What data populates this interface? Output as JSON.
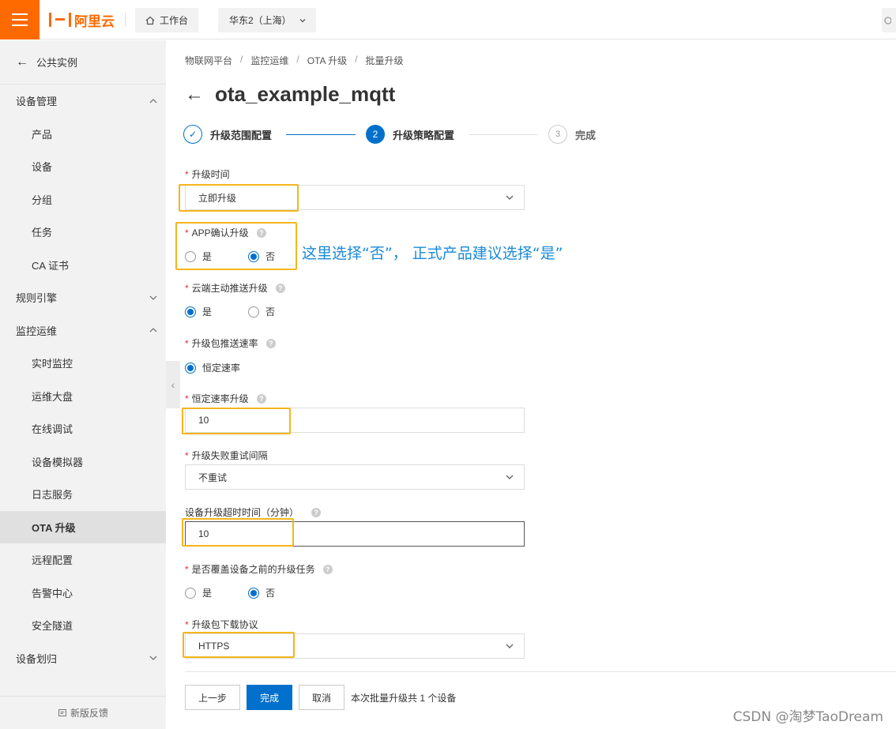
{
  "topbar": {
    "logo_text": "阿里云",
    "workbench_label": "工作台",
    "region_label": "华东2（上海）"
  },
  "sidebar": {
    "back_label": "公共实例",
    "items": [
      {
        "label": "设备管理",
        "type": "group",
        "expanded": true
      },
      {
        "label": "产品",
        "type": "child"
      },
      {
        "label": "设备",
        "type": "child"
      },
      {
        "label": "分组",
        "type": "child"
      },
      {
        "label": "任务",
        "type": "child"
      },
      {
        "label": "CA 证书",
        "type": "child"
      },
      {
        "label": "规则引擎",
        "type": "group",
        "expanded": false
      },
      {
        "label": "监控运维",
        "type": "group",
        "expanded": true
      },
      {
        "label": "实时监控",
        "type": "child"
      },
      {
        "label": "运维大盘",
        "type": "child"
      },
      {
        "label": "在线调试",
        "type": "child"
      },
      {
        "label": "设备模拟器",
        "type": "child"
      },
      {
        "label": "日志服务",
        "type": "child"
      },
      {
        "label": "OTA 升级",
        "type": "child",
        "active": true
      },
      {
        "label": "远程配置",
        "type": "child"
      },
      {
        "label": "告警中心",
        "type": "child"
      },
      {
        "label": "安全隧道",
        "type": "child"
      },
      {
        "label": "设备划归",
        "type": "group",
        "expanded": false
      }
    ],
    "feedback_label": "新版反馈"
  },
  "breadcrumb": [
    "物联网平台",
    "监控运维",
    "OTA 升级",
    "批量升级"
  ],
  "page_title": "ota_example_mqtt",
  "steps": [
    {
      "label": "升级范围配置",
      "status": "done",
      "marker": "✓"
    },
    {
      "label": "升级策略配置",
      "status": "current",
      "marker": "2"
    },
    {
      "label": "完成",
      "status": "todo",
      "marker": "3"
    }
  ],
  "form": {
    "upgrade_time": {
      "label": "升级时间",
      "value": "立即升级"
    },
    "app_confirm": {
      "label": "APP确认升级",
      "options": [
        "是",
        "否"
      ],
      "selected": "否"
    },
    "cloud_push": {
      "label": "云端主动推送升级",
      "options": [
        "是",
        "否"
      ],
      "selected": "是"
    },
    "push_rate": {
      "label": "升级包推送速率",
      "options": [
        "恒定速率"
      ],
      "selected": "恒定速率"
    },
    "constant_rate": {
      "label": "恒定速率升级",
      "value": "10"
    },
    "retry_interval": {
      "label": "升级失败重试间隔",
      "value": "不重试"
    },
    "timeout": {
      "label": "设备升级超时时间（分钟）",
      "value": "10"
    },
    "overwrite": {
      "label": "是否覆盖设备之前的升级任务",
      "options": [
        "是",
        "否"
      ],
      "selected": "否"
    },
    "protocol": {
      "label": "升级包下载协议",
      "value": "HTTPS"
    }
  },
  "annotation": "这里选择“否”， 正式产品建议选择“是”",
  "footer": {
    "prev_label": "上一步",
    "finish_label": "完成",
    "cancel_label": "取消",
    "summary_prefix": "本次批量升级共",
    "summary_count": "1",
    "summary_suffix": "个设备"
  },
  "watermark": "CSDN @淘梦TaoDream",
  "colors": {
    "brand": "#ff6a00",
    "primary": "#0070cc",
    "highlight": "#f5b51e",
    "annotation": "#1a8ad8",
    "required": "#e62e2e"
  }
}
